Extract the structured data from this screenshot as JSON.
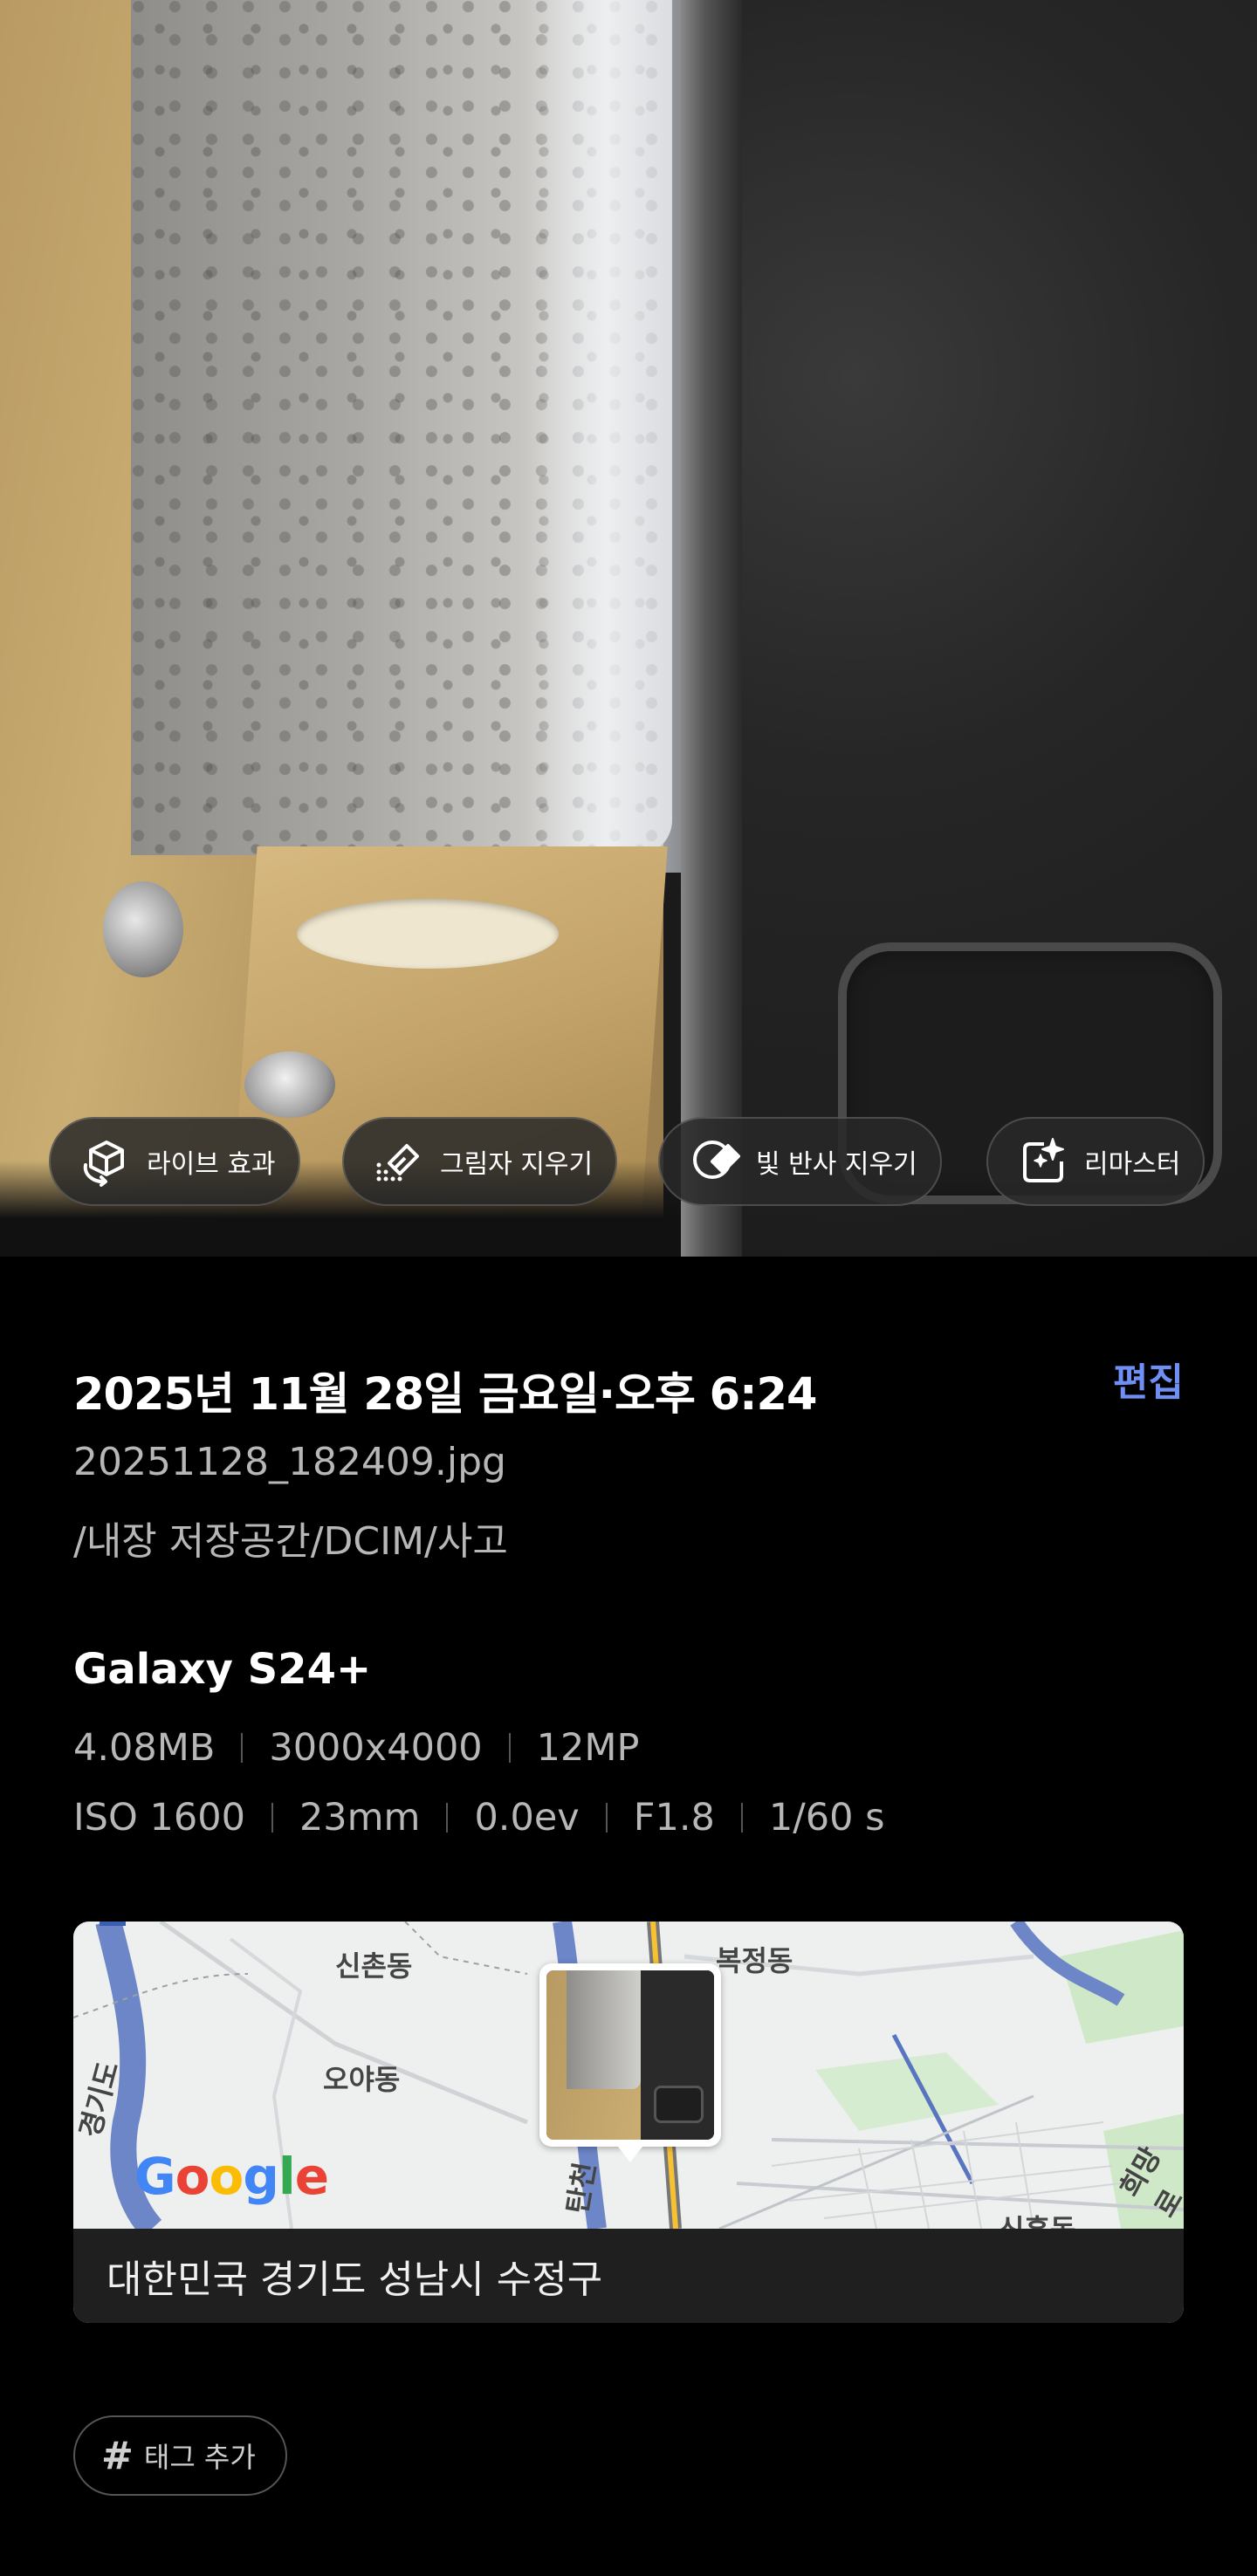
{
  "photo": {
    "actions": [
      {
        "id": "live-effect",
        "label": "라이브 효과",
        "icon": "cube-rotate-icon"
      },
      {
        "id": "shadow-erase",
        "label": "그림자 지우기",
        "icon": "eraser-icon"
      },
      {
        "id": "reflection-erase",
        "label": "빛 반사 지우기",
        "icon": "reflection-eraser-icon"
      },
      {
        "id": "remaster",
        "label": "리마스터",
        "icon": "sparkle-image-icon"
      }
    ]
  },
  "details": {
    "datetime": "2025년 11월 28일 금요일·오후 6:24",
    "edit_label": "편집",
    "filename": "20251128_182409.jpg",
    "path": "/내장 저장공간/DCIM/사고",
    "device": "Galaxy S24+",
    "specs_row1": [
      "4.08MB",
      "3000x4000",
      "12MP"
    ],
    "specs_row2": [
      "ISO 1600",
      "23mm",
      "0.0ev",
      "F1.8",
      "1/60 s"
    ]
  },
  "map": {
    "labels": {
      "sinchon": "신촌동",
      "oya": "오야동",
      "bokjeong": "복정동",
      "gyeonggi": "경기도",
      "tancheon": "탄천",
      "huimang": "희망로",
      "bottom_left": "",
      "bottom_right": "신흥동"
    },
    "google_logo": "Google",
    "address": "대한민국 경기도 성남시 수정구"
  },
  "tag": {
    "label": "태그 추가",
    "hash": "#"
  },
  "colors": {
    "accent": "#6f8ff5",
    "background": "#000000",
    "secondary_text": "#b7b7b7"
  }
}
